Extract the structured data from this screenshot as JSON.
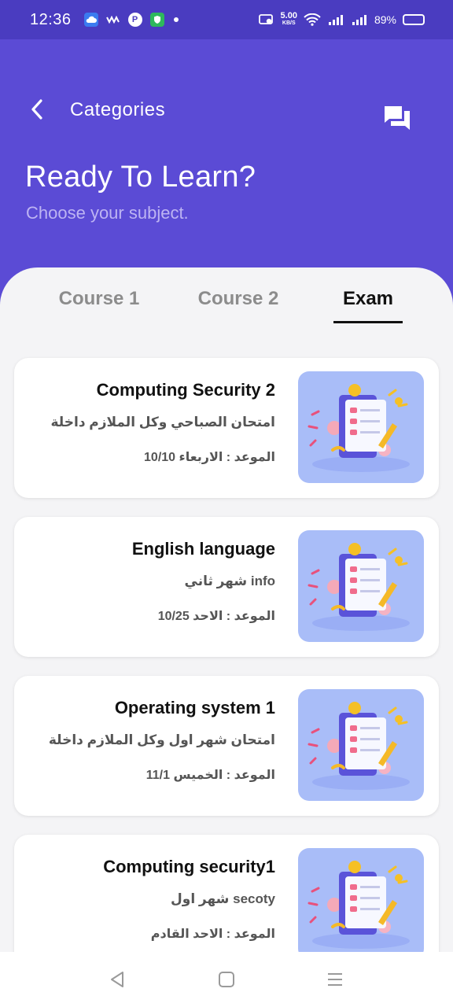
{
  "status_bar": {
    "time": "12:36",
    "speed_value": "5.00",
    "speed_unit": "KB/S",
    "battery": "89%"
  },
  "header": {
    "back_icon": "chevron-left-icon",
    "title": "Categories",
    "chat_icon": "chat-bubbles-icon",
    "hero_title": "Ready To Learn?",
    "hero_subtitle": "Choose your subject."
  },
  "tabs": [
    {
      "label": "Course 1",
      "active": false
    },
    {
      "label": "Course 2",
      "active": false
    },
    {
      "label": "Exam",
      "active": true
    }
  ],
  "cards": [
    {
      "title": "Computing Security 2",
      "description": "امتحان الصباحي وكل الملازم داخلة",
      "date": "الموعد : الاربعاء 10/10"
    },
    {
      "title": "English language",
      "description": "info شهر ثاني",
      "date": "الموعد : الاحد 10/25"
    },
    {
      "title": "Operating system 1",
      "description": "امتحان شهر اول وكل الملازم داخلة",
      "date": "الموعد : الخميس 11/1"
    },
    {
      "title": "Computing security1",
      "description": "secoty شهر اول",
      "date": "الموعد : الاحد القادم"
    }
  ],
  "colors": {
    "primary": "#5b4bd5",
    "status_bar": "#4a3cc0",
    "thumb_bg": "#a9bdf8"
  },
  "bottom_nav": {
    "icons": [
      "back-triangle-icon",
      "home-square-icon",
      "recents-menu-icon"
    ]
  }
}
